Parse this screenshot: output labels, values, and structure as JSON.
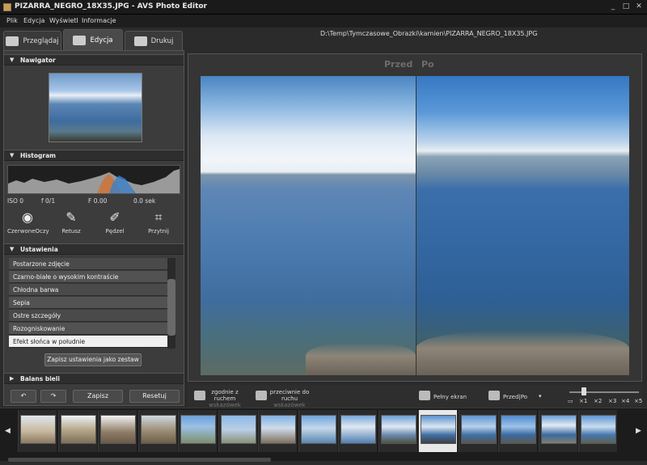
{
  "window": {
    "title": "PIZARRA_NEGRO_18X35.JPG - AVS Photo Editor",
    "minimize": "_",
    "maximize": "□",
    "close": "✕"
  },
  "menu": [
    "Plik",
    "Edycja",
    "Wyświetl",
    "Informacje"
  ],
  "tabs": [
    {
      "label": "Przeglądaj"
    },
    {
      "label": "Edycja"
    },
    {
      "label": "Drukuj"
    }
  ],
  "file_path": "D:\\Temp\\Tymczasowe_Obrazki\\kamien\\PIZARRA_NEGRO_18X35.JPG",
  "navigator": {
    "title": "Nawigator"
  },
  "histogram": {
    "title": "Histogram",
    "iso": "ISO 0",
    "aperture": "f 0/1",
    "f": "F 0.00",
    "exposure": "0.0 sek"
  },
  "tools": [
    {
      "label": "CzerwoneOczy",
      "icon": "eye-icon"
    },
    {
      "label": "Retusz",
      "icon": "retouch-icon"
    },
    {
      "label": "Pędzel",
      "icon": "brush-icon"
    },
    {
      "label": "Przytnij",
      "icon": "crop-icon"
    }
  ],
  "settings": {
    "title": "Ustawienia",
    "items": [
      "Postarzone zdjęcie",
      "Czarno-białe o wysokim kontraście",
      "Chłodna barwa",
      "Sepia",
      "Ostre szczegóły",
      "Rozogniskowanie",
      "Efekt słońca w południe"
    ],
    "selected_index": 6,
    "save_preset": "Zapisz ustawienia jako zestaw"
  },
  "white_balance": {
    "title": "Balans bieli"
  },
  "bottom_buttons": {
    "save": "Zapisz",
    "reset": "Resetuj"
  },
  "viewer": {
    "before": "Przed",
    "after": "Po"
  },
  "controls": {
    "rotate_cw_line1": "zgodnie z",
    "rotate_cw_line2": "ruchem",
    "rotate_cw_line3": "wskazówek",
    "rotate_ccw_line1": "przeciwnie do",
    "rotate_ccw_line2": "ruchu",
    "rotate_ccw_line3": "wskazówek",
    "fullscreen": "Pełny ekran",
    "compare": "Przed|Po",
    "zoom_levels": [
      "×1",
      "×2",
      "×3",
      "×4",
      "×5"
    ]
  },
  "filmstrip": {
    "count": 15,
    "selected_index": 10
  }
}
